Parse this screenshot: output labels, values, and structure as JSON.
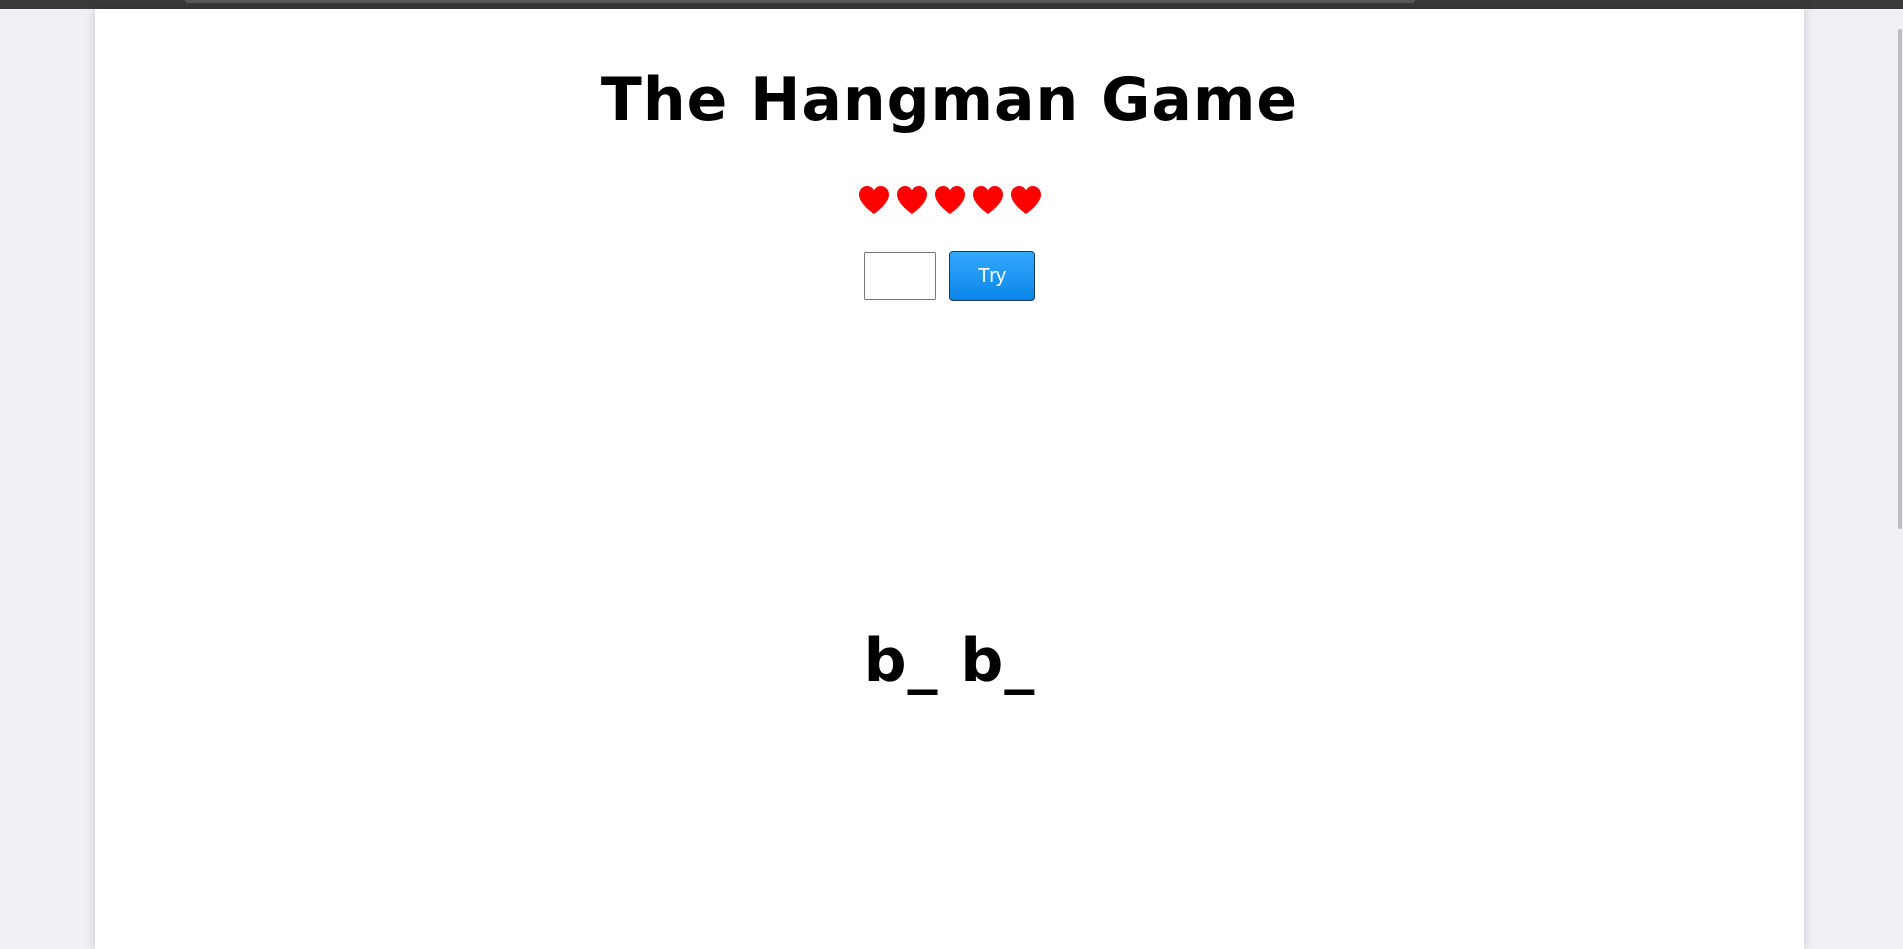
{
  "game": {
    "title": "The Hangman Game",
    "lives": 5,
    "heart_color": "#ff0000",
    "guess_input": {
      "value": "",
      "placeholder": ""
    },
    "try_label": "Try",
    "try_color": "#1e96f5",
    "word_display": "b_ b_"
  }
}
